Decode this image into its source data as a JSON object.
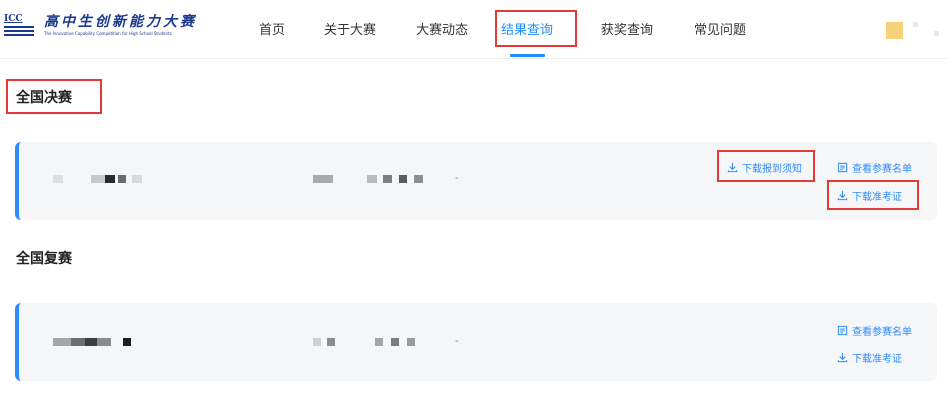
{
  "logo": {
    "abbr": "ICC",
    "title_cn": "高中生创新能力大赛",
    "title_en": "The Innovative Capability Competition for High School Students"
  },
  "nav": {
    "items": [
      {
        "label": "首页",
        "active": false
      },
      {
        "label": "关于大赛",
        "active": false
      },
      {
        "label": "大赛动态",
        "active": false
      },
      {
        "label": "结果查询",
        "active": true
      },
      {
        "label": "获奖查询",
        "active": false
      },
      {
        "label": "常见问题",
        "active": false
      }
    ]
  },
  "sections": [
    {
      "title": "全国决赛",
      "card": {
        "dash": "-",
        "actions": {
          "download_notice": "下载报到须知",
          "view_list": "查看参赛名单",
          "download_ticket": "下载准考证"
        }
      }
    },
    {
      "title": "全国复赛",
      "card": {
        "dash": "-",
        "actions": {
          "view_list": "查看参赛名单",
          "download_ticket": "下载准考证"
        }
      }
    }
  ],
  "colors": {
    "accent": "#2d8cff",
    "highlight_box": "#e53935",
    "brand": "#1b3a8f",
    "card_bg": "#f5f6f8"
  }
}
